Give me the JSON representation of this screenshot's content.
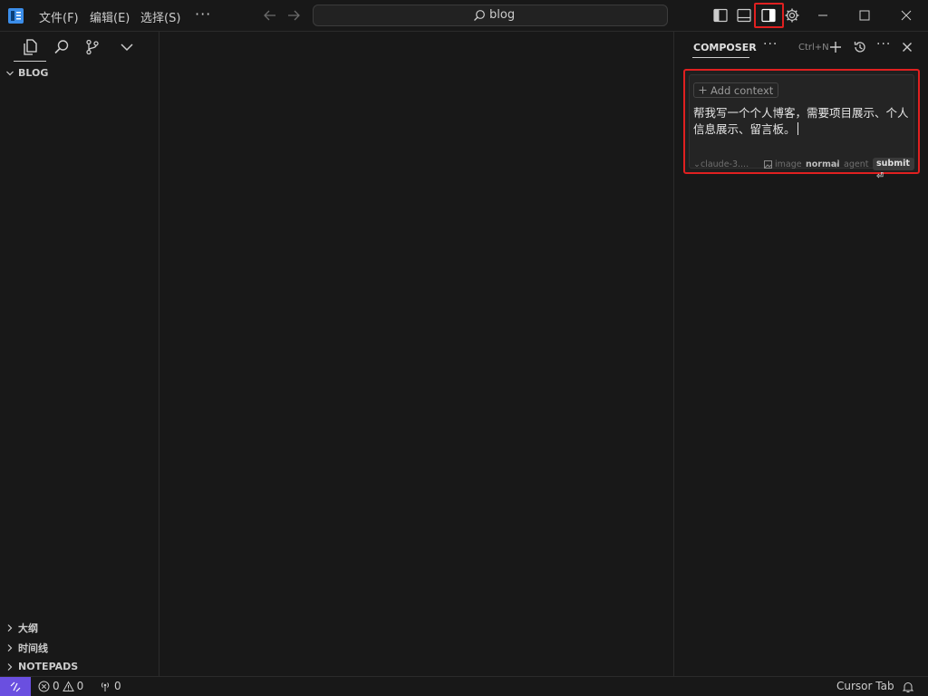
{
  "titlebar": {
    "menu": [
      "文件(F)",
      "编辑(E)",
      "选择(S)"
    ],
    "more": "···",
    "search_text": "blog"
  },
  "sidebar": {
    "root_folder": "BLOG",
    "sections": [
      "大纲",
      "时间线",
      "NOTEPADS"
    ]
  },
  "composer": {
    "title": "COMPOSER",
    "more": "···",
    "shortcut": "Ctrl+N",
    "add_context": "Add context",
    "prompt": "帮我写一个个人博客，需要项目展示、个人信息展示、留言板。",
    "model": "⌄claude-3....",
    "image_label": "image",
    "mode_normal": "normal",
    "mode_sep": "/",
    "mode_agent": "agent",
    "submit": "submit ⏎"
  },
  "statusbar": {
    "errors": "0",
    "warnings": "0",
    "ports": "0",
    "cursor_tab": "Cursor Tab"
  },
  "colors": {
    "background": "#181818",
    "accent_purple": "#6a4fe0",
    "highlight_red": "#e02020",
    "logo_blue": "#3b8eea"
  }
}
